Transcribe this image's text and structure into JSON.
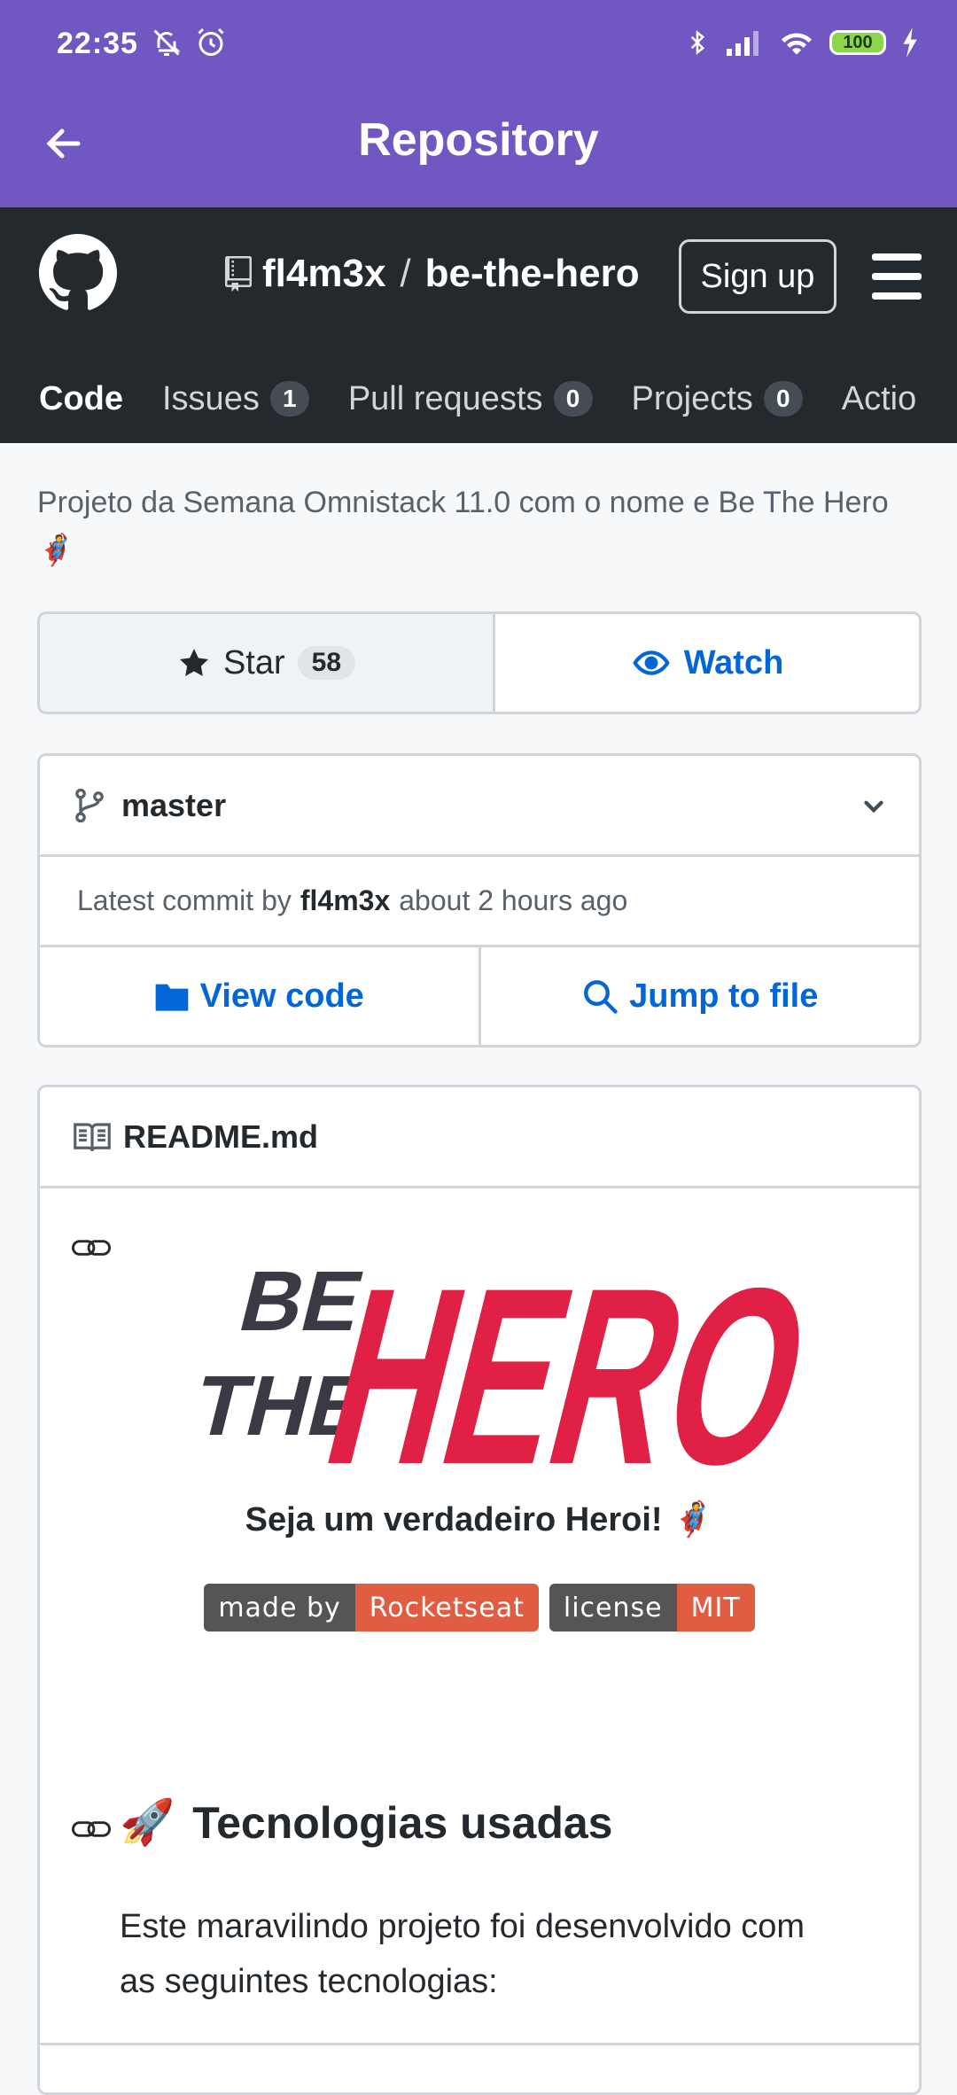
{
  "status_bar": {
    "time": "22:35",
    "battery": "100"
  },
  "app_bar": {
    "title": "Repository"
  },
  "repo": {
    "owner": "fl4m3x",
    "separator": "/",
    "name": "be-the-hero",
    "signup_label": "Sign up"
  },
  "tabs": [
    {
      "label": "Code"
    },
    {
      "label": "Issues",
      "count": "1"
    },
    {
      "label": "Pull requests",
      "count": "0"
    },
    {
      "label": "Projects",
      "count": "0"
    },
    {
      "label": "Actio"
    }
  ],
  "description": "Projeto da Semana Omnistack 11.0 com o nome e Be The Hero 🦸",
  "star": {
    "label": "Star",
    "count": "58"
  },
  "watch": {
    "label": "Watch"
  },
  "branch": {
    "name": "master"
  },
  "commit": {
    "prefix": "Latest commit by",
    "author": "fl4m3x",
    "time": "about 2 hours ago"
  },
  "actions": {
    "view_code": "View code",
    "jump_to_file": "Jump to file"
  },
  "readme": {
    "title": "README.md",
    "logo_words": [
      "BE",
      "THE",
      "HERO"
    ],
    "tagline": "Seja um verdadeiro Heroi! 🦸",
    "badges": [
      {
        "label": "made by",
        "value": "Rocketseat"
      },
      {
        "label": "license",
        "value": "MIT"
      }
    ],
    "heading_emoji": "🚀",
    "heading": "Tecnologias usadas",
    "paragraph": "Este maravilindo projeto foi desenvolvido com as seguintes tecnologias:"
  },
  "colors": {
    "app_bar": "#7057c1",
    "github_header": "#24292e",
    "link": "#0366d6",
    "hero_red": "#e02044",
    "badge_left": "#555555",
    "badge_right": "#e05d44"
  }
}
